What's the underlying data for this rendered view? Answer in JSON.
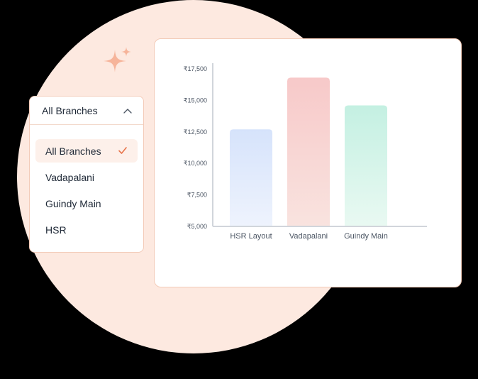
{
  "colors": {
    "background": "#000000",
    "circle": "#fde9e0",
    "card_border": "#f3cbb8",
    "accent": "#e8744a",
    "sparkle": "#f6b49a"
  },
  "decorations": {
    "sparkle_icon": "sparkle-icon"
  },
  "dropdown": {
    "selected_label": "All Branches",
    "toggle_icon": "chevron-up-icon",
    "check_icon": "checkmark-icon",
    "selected_index": 0,
    "options": [
      {
        "label": "All Branches"
      },
      {
        "label": "Vadapalani"
      },
      {
        "label": "Guindy Main"
      },
      {
        "label": "HSR"
      }
    ]
  },
  "chart_data": {
    "type": "bar",
    "categories": [
      "HSR Layout",
      "Vadapalani",
      "Guindy Main"
    ],
    "values": [
      12700,
      16800,
      14600
    ],
    "ylim": [
      5000,
      17500
    ],
    "yticks": [
      "₹17,500",
      "₹15,000",
      "₹12,500",
      "₹10,000",
      "₹7,500",
      "₹5,000"
    ],
    "ytick_values": [
      17500,
      15000,
      12500,
      10000,
      7500,
      5000
    ],
    "bar_colors": [
      [
        "#d6e3fb",
        "#eef3fd"
      ],
      [
        "#f7c9c9",
        "#f9e3df"
      ],
      [
        "#c4f0e2",
        "#e9f9f2"
      ]
    ],
    "grid": false,
    "legend": "none"
  }
}
